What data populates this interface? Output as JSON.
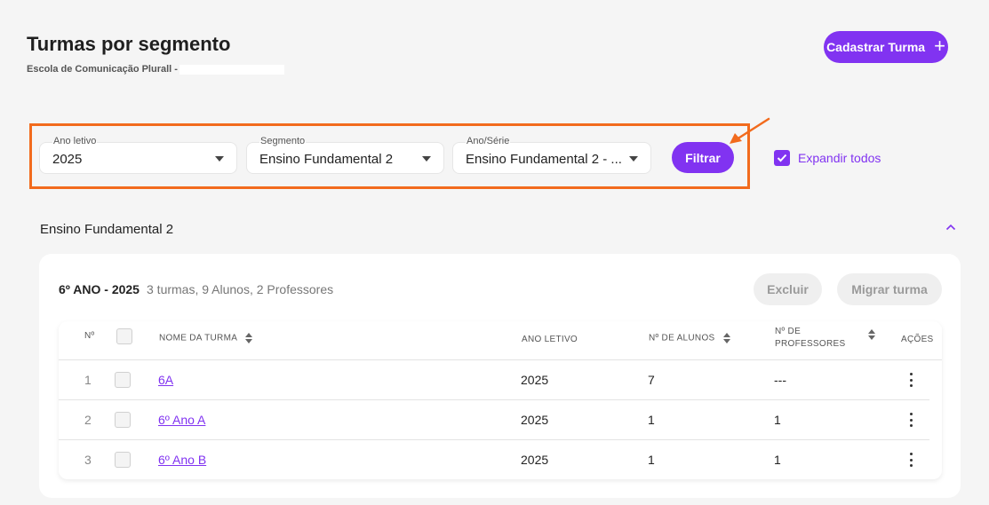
{
  "header": {
    "title": "Turmas por segmento",
    "subtitle": "Escola de Comunicação Plurall -",
    "create_button": "Cadastrar Turma",
    "create_icon": "+"
  },
  "filters": {
    "ano_letivo": {
      "label": "Ano letivo",
      "value": "2025"
    },
    "segmento": {
      "label": "Segmento",
      "value": "Ensino Fundamental 2"
    },
    "ano_serie": {
      "label": "Ano/Série",
      "value": "Ensino Fundamental 2 - ..."
    },
    "filter_button": "Filtrar",
    "expand_all": {
      "label": "Expandir todos",
      "checked": true
    }
  },
  "section": {
    "title": "Ensino Fundamental 2"
  },
  "group": {
    "title": "6º ANO - 2025",
    "info": "3 turmas, 9 Alunos, 2 Professores",
    "delete_button": "Excluir",
    "migrate_button": "Migrar turma"
  },
  "table": {
    "headers": {
      "num": "Nº",
      "name": "NOME DA TURMA",
      "year": "ANO LETIVO",
      "students": "Nº DE ALUNOS",
      "teachers_line1": "Nº DE",
      "teachers_line2": "PROFESSORES",
      "actions": "AÇÕES"
    },
    "rows": [
      {
        "num": "1",
        "name": "6A",
        "year": "2025",
        "students": "7",
        "teachers": "---"
      },
      {
        "num": "2",
        "name": "6º Ano A",
        "year": "2025",
        "students": "1",
        "teachers": "1"
      },
      {
        "num": "3",
        "name": "6º Ano B",
        "year": "2025",
        "students": "1",
        "teachers": "1"
      }
    ]
  },
  "colors": {
    "accent": "#8133f1",
    "highlight": "#f26b1d"
  }
}
